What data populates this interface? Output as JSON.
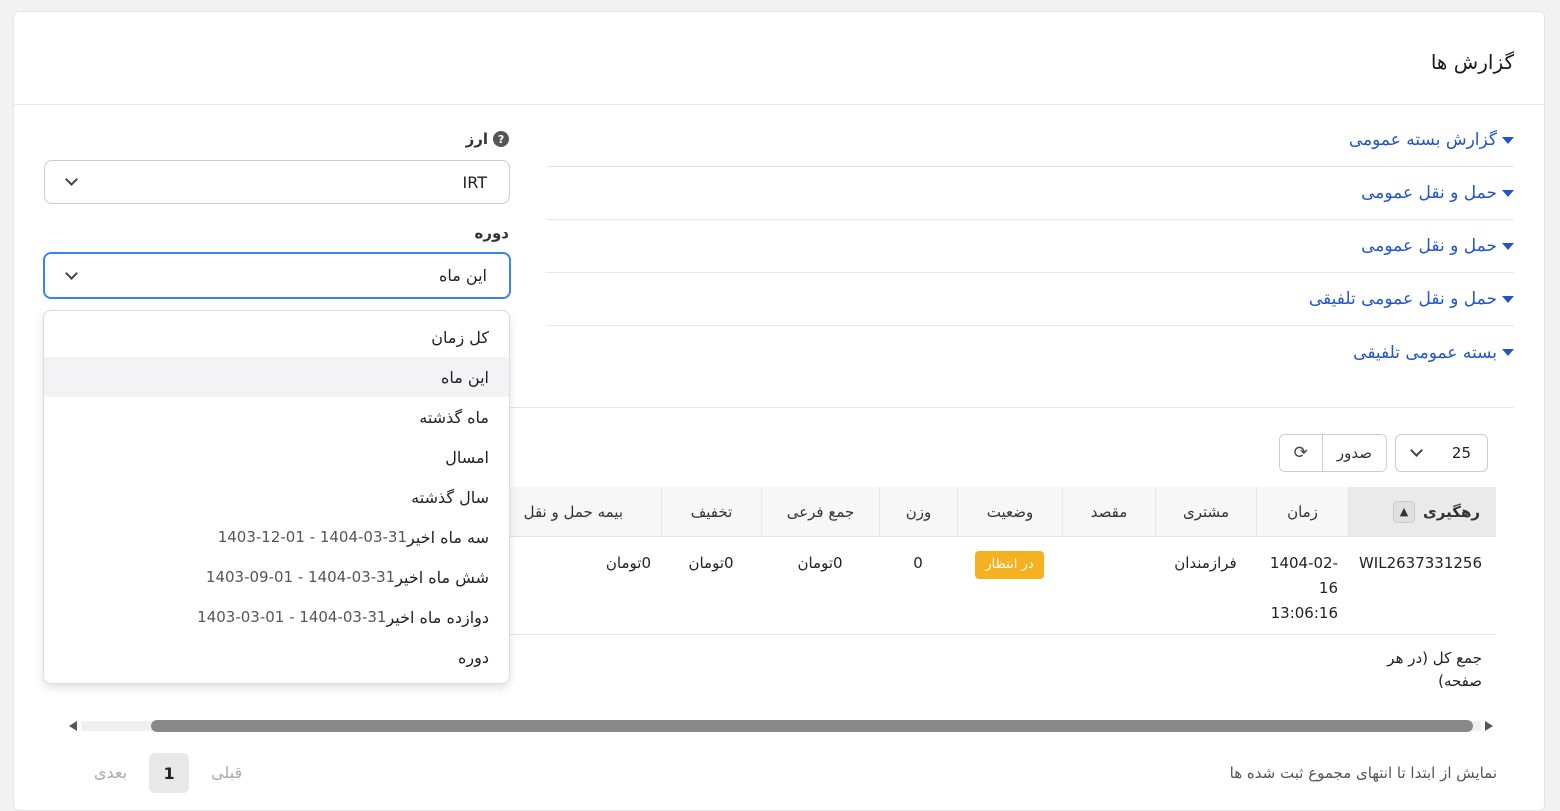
{
  "page": {
    "title": "گزارش ها"
  },
  "accordion": [
    {
      "label": "گزارش بسته عمومی"
    },
    {
      "label": "حمل و نقل عمومی"
    },
    {
      "label": "حمل و نقل عمومی"
    },
    {
      "label": "حمل و نقل عمومی تلفیقی"
    },
    {
      "label": "بسته عمومی تلفیقی"
    }
  ],
  "filters": {
    "currency_label": "ارز",
    "currency_value": "IRT",
    "period_label": "دوره",
    "period_value": "این ماه"
  },
  "period_options": [
    {
      "label": "کل زمان",
      "range": ""
    },
    {
      "label": "این ماه",
      "range": ""
    },
    {
      "label": "ماه گذشته",
      "range": ""
    },
    {
      "label": "امسال",
      "range": ""
    },
    {
      "label": "سال گذشته",
      "range": ""
    },
    {
      "label": "سه ماه اخیر",
      "range": "1403-12-01 - 1404-03-31"
    },
    {
      "label": "شش ماه اخیر",
      "range": "1403-09-01 - 1404-03-31"
    },
    {
      "label": "دوازده ماه اخیر",
      "range": "1403-03-01 - 1404-03-31"
    },
    {
      "label": "دوره",
      "range": ""
    }
  ],
  "toolbar": {
    "page_size": "25",
    "export_label": "صدور"
  },
  "table": {
    "headers": [
      "رهگیری",
      "زمان",
      "مشتری",
      "مقصد",
      "وضعیت",
      "وزن",
      "جمع فرعی",
      "تخفیف",
      "بیمه حمل و نقل"
    ],
    "rows": [
      {
        "tracking": "WIL2637331256",
        "time": "1404-02-16 13:06:16",
        "customer": "فرازمندان",
        "destination": "",
        "status": "در انتظار",
        "weight": "0",
        "subtotal": "0تومان",
        "discount": "0تومان",
        "insurance": "0تومان"
      }
    ],
    "footer_label": "جمع کل (در هر صفحه)"
  },
  "pagination": {
    "prev": "قبلی",
    "current": "1",
    "next": "بعدی"
  },
  "showing_text": "نمایش از ابتدا تا انتهای مجموع ثبت شده ها"
}
